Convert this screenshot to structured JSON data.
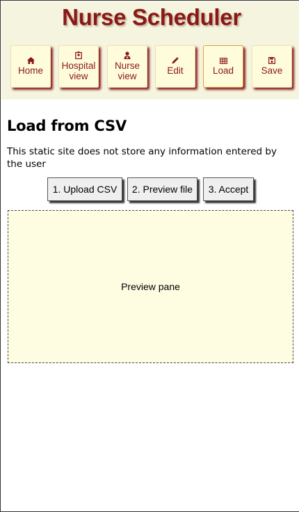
{
  "header": {
    "app_title": "Nurse Scheduler",
    "accent_color": "#8a1818",
    "background_color": "#f5f4de"
  },
  "nav": {
    "items": [
      {
        "id": "home",
        "icon": "home-icon",
        "lines": [
          "Home"
        ],
        "active": false
      },
      {
        "id": "hospital-view",
        "icon": "hospital-icon",
        "lines": [
          "Hospital",
          "view"
        ],
        "active": false
      },
      {
        "id": "nurse-view",
        "icon": "user-nurse-icon",
        "lines": [
          "Nurse",
          "view"
        ],
        "active": false
      },
      {
        "id": "edit",
        "icon": "pencil-icon",
        "lines": [
          "Edit"
        ],
        "active": false
      },
      {
        "id": "load",
        "icon": "table-icon",
        "lines": [
          "Load"
        ],
        "active": true
      },
      {
        "id": "save",
        "icon": "floppy-disk-icon",
        "lines": [
          "Save"
        ],
        "active": false
      }
    ]
  },
  "main": {
    "heading": "Load from CSV",
    "notice": "This static site does not store any information entered by the user",
    "steps": [
      {
        "id": "upload",
        "label": "1. Upload CSV"
      },
      {
        "id": "preview",
        "label": "2. Preview file"
      },
      {
        "id": "accept",
        "label": "3. Accept"
      }
    ],
    "preview_pane": {
      "label": "Preview pane",
      "background_color": "#fefde2"
    }
  }
}
